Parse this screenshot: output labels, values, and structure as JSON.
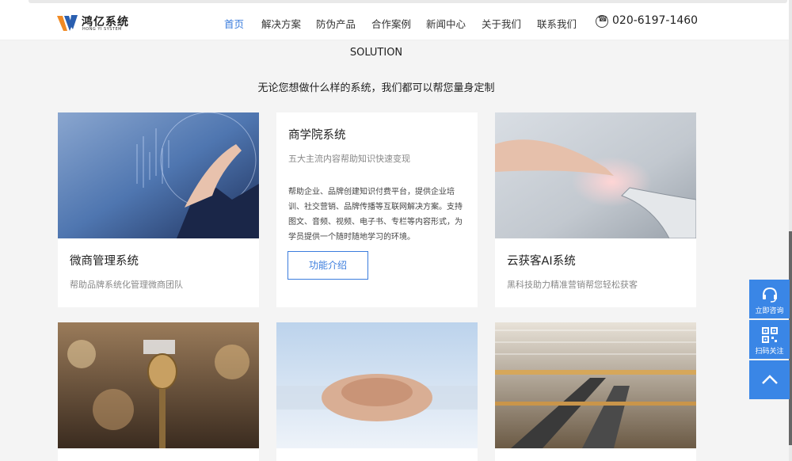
{
  "brand": {
    "name": "鸿亿系统",
    "sub": "HONG YI SYSTEM",
    "colors": {
      "accent": "#3b7ddd",
      "float": "#3a86e6"
    }
  },
  "nav": {
    "items": [
      "首页",
      "解决方案",
      "防伪产品",
      "合作案例",
      "新闻中心",
      "关于我们",
      "联系我们"
    ],
    "active_index": 0
  },
  "phone": {
    "icon": "phone-icon",
    "number": "020-6197-1460"
  },
  "section": {
    "title": "SOLUTION",
    "subtitle": "无论您想做什么样的系统，我们都可以帮您量身定制"
  },
  "cards": [
    {
      "title": "微商管理系统",
      "desc": "帮助品牌系统化管理微商团队",
      "image": "business-hand-touch-photo"
    },
    {
      "title": "商学院系统",
      "desc": "五大主流内容帮助知识快速变现",
      "body": "帮助企业、品牌创建知识付费平台，提供企业培训、社交营销、品牌传播等互联网解决方案。支持图文、音频、视频、电子书、专栏等内容形式，为学员提供一个随时随地学习的环境。",
      "button": "功能介绍"
    },
    {
      "title": "云获客AI系统",
      "desc": "黑科技助力精准营销帮您轻松获客",
      "image": "human-robot-hands-photo"
    },
    {
      "image": "news-microphone-photo"
    },
    {
      "image": "team-hands-stack-photo"
    },
    {
      "image": "mall-escalator-photo"
    }
  ],
  "float_bar": {
    "consult": {
      "label": "立即咨询",
      "icon": "headset-icon"
    },
    "qr": {
      "label": "扫码关注",
      "icon": "qrcode-icon"
    },
    "top": {
      "icon": "arrow-up-icon"
    }
  }
}
